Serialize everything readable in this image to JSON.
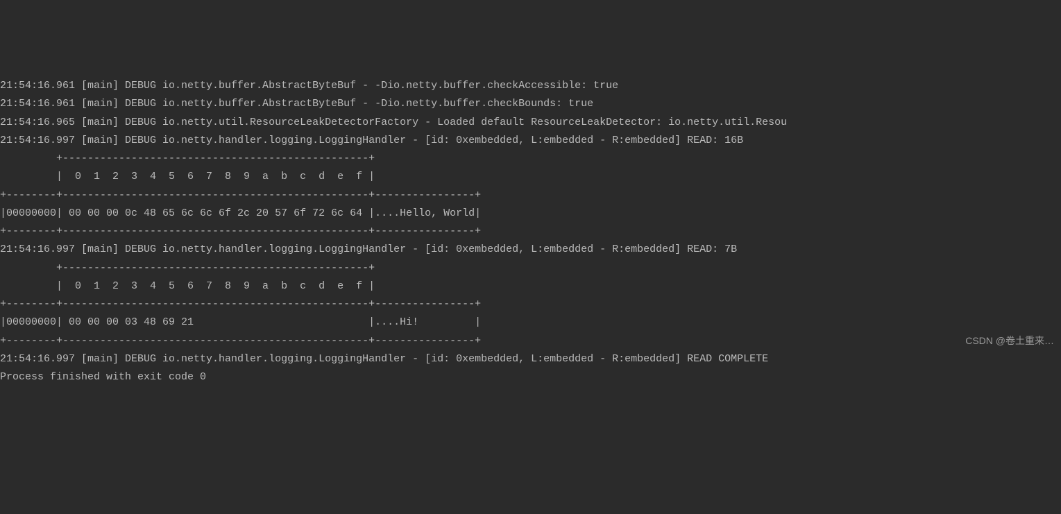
{
  "lines": [
    "21:54:16.961 [main] DEBUG io.netty.buffer.AbstractByteBuf - -Dio.netty.buffer.checkAccessible: true",
    "21:54:16.961 [main] DEBUG io.netty.buffer.AbstractByteBuf - -Dio.netty.buffer.checkBounds: true",
    "21:54:16.965 [main] DEBUG io.netty.util.ResourceLeakDetectorFactory - Loaded default ResourceLeakDetector: io.netty.util.Resou",
    "21:54:16.997 [main] DEBUG io.netty.handler.logging.LoggingHandler - [id: 0xembedded, L:embedded - R:embedded] READ: 16B",
    "         +-------------------------------------------------+",
    "         |  0  1  2  3  4  5  6  7  8  9  a  b  c  d  e  f |",
    "+--------+-------------------------------------------------+----------------+",
    "|00000000| 00 00 00 0c 48 65 6c 6c 6f 2c 20 57 6f 72 6c 64 |....Hello, World|",
    "+--------+-------------------------------------------------+----------------+",
    "21:54:16.997 [main] DEBUG io.netty.handler.logging.LoggingHandler - [id: 0xembedded, L:embedded - R:embedded] READ: 7B",
    "         +-------------------------------------------------+",
    "         |  0  1  2  3  4  5  6  7  8  9  a  b  c  d  e  f |",
    "+--------+-------------------------------------------------+----------------+",
    "|00000000| 00 00 00 03 48 69 21                            |....Hi!         |",
    "+--------+-------------------------------------------------+----------------+",
    "21:54:16.997 [main] DEBUG io.netty.handler.logging.LoggingHandler - [id: 0xembedded, L:embedded - R:embedded] READ COMPLETE",
    "",
    "Process finished with exit code 0"
  ],
  "watermark": "CSDN @卷土重来…"
}
